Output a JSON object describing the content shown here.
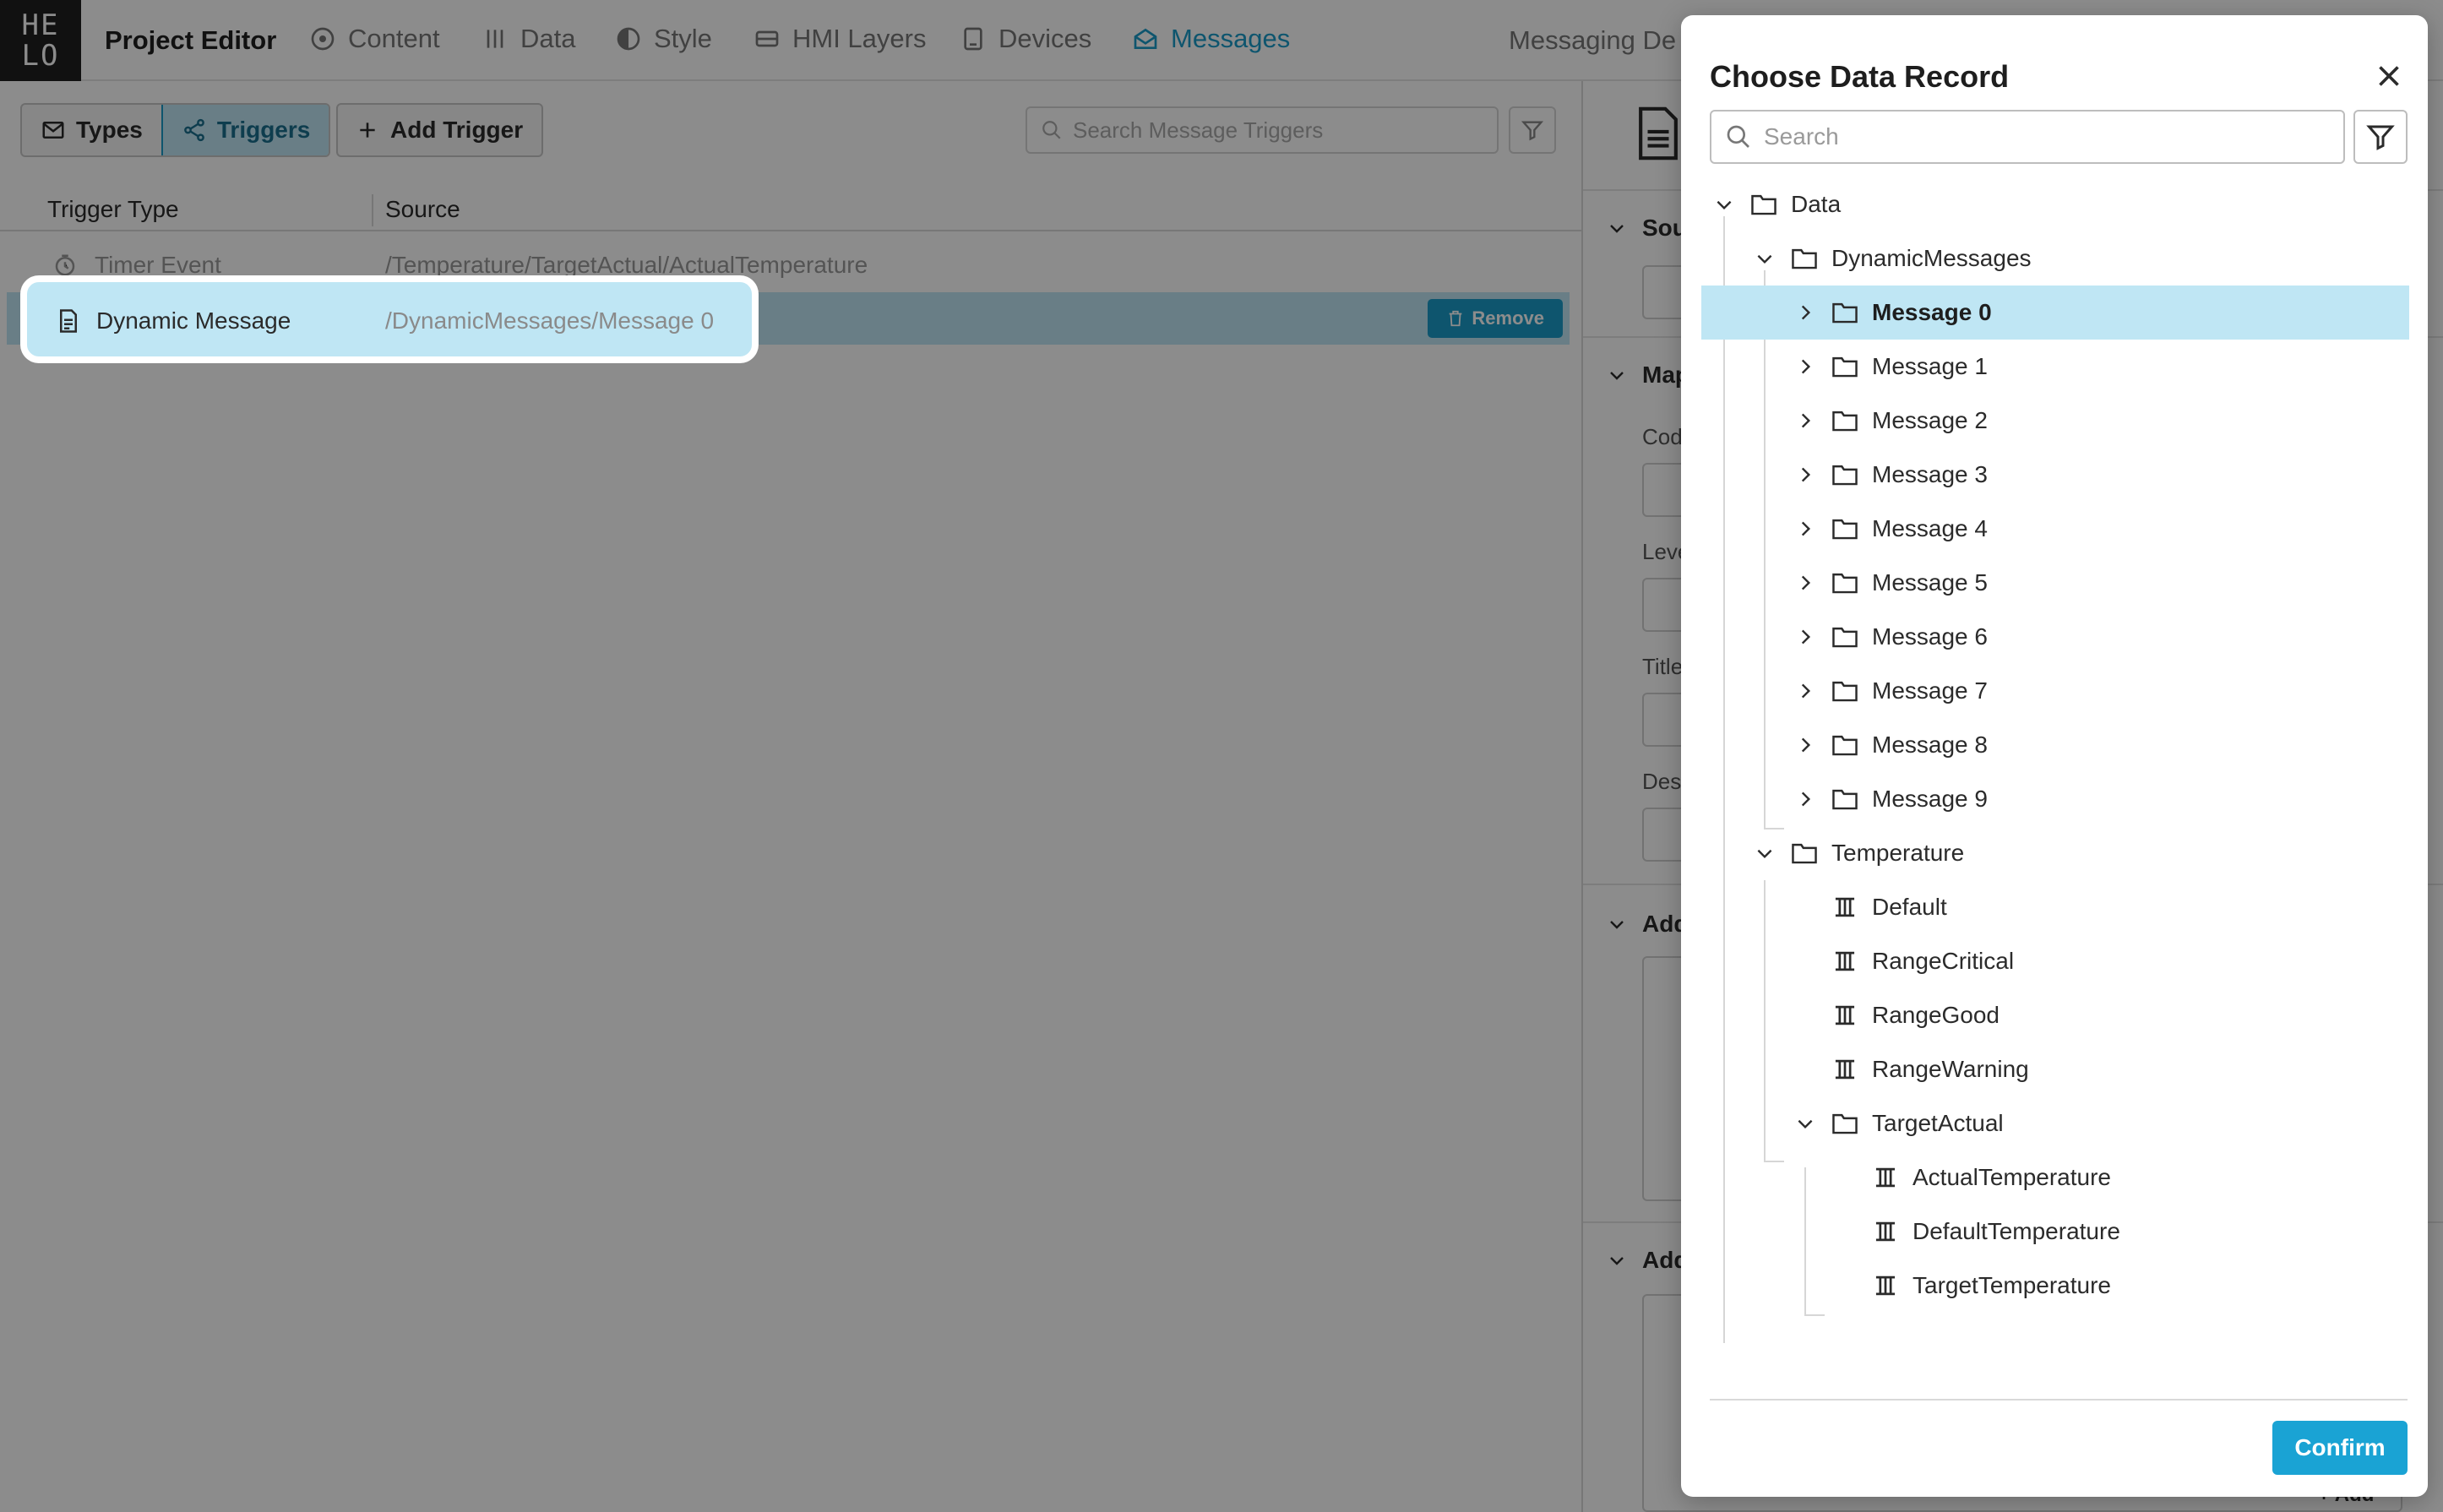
{
  "app": {
    "logo_text": "HE LO",
    "title": "Project Editor"
  },
  "nav": {
    "tabs": [
      {
        "label": "Content",
        "icon": "content-icon"
      },
      {
        "label": "Data",
        "icon": "data-icon"
      },
      {
        "label": "Style",
        "icon": "style-icon"
      },
      {
        "label": "HMI Layers",
        "icon": "layers-icon"
      },
      {
        "label": "Devices",
        "icon": "devices-icon"
      },
      {
        "label": "Messages",
        "icon": "messages-icon",
        "active": true
      }
    ],
    "extra": "Messaging De"
  },
  "toolbar": {
    "types_label": "Types",
    "triggers_label": "Triggers",
    "add_trigger_label": "Add Trigger",
    "search_placeholder": "Search Message Triggers"
  },
  "table": {
    "headers": [
      "Trigger Type",
      "Source"
    ],
    "rows": [
      {
        "type": "Timer Event",
        "source": "/Temperature/TargetActual/ActualTemperature"
      },
      {
        "type": "Dynamic Message",
        "source": "/DynamicMessages/Message 0",
        "selected": true
      }
    ],
    "remove_label": "Remove"
  },
  "side_panel": {
    "sections": [
      "Sou",
      "Map",
      "Add",
      "Add"
    ],
    "labels": [
      "Cod",
      "Leve",
      "Title",
      "Desc"
    ],
    "add_label": "+ Add"
  },
  "modal": {
    "title": "Choose Data Record",
    "search_placeholder": "Search",
    "confirm_label": "Confirm",
    "tree": [
      {
        "label": "Data",
        "depth": 0,
        "kind": "folder",
        "chevron": "down"
      },
      {
        "label": "DynamicMessages",
        "depth": 1,
        "kind": "folder",
        "chevron": "down"
      },
      {
        "label": "Message 0",
        "depth": 2,
        "kind": "folder",
        "chevron": "right",
        "selected": true
      },
      {
        "label": "Message 1",
        "depth": 2,
        "kind": "folder",
        "chevron": "right"
      },
      {
        "label": "Message 2",
        "depth": 2,
        "kind": "folder",
        "chevron": "right"
      },
      {
        "label": "Message 3",
        "depth": 2,
        "kind": "folder",
        "chevron": "right"
      },
      {
        "label": "Message 4",
        "depth": 2,
        "kind": "folder",
        "chevron": "right"
      },
      {
        "label": "Message 5",
        "depth": 2,
        "kind": "folder",
        "chevron": "right"
      },
      {
        "label": "Message 6",
        "depth": 2,
        "kind": "folder",
        "chevron": "right"
      },
      {
        "label": "Message 7",
        "depth": 2,
        "kind": "folder",
        "chevron": "right"
      },
      {
        "label": "Message 8",
        "depth": 2,
        "kind": "folder",
        "chevron": "right"
      },
      {
        "label": "Message 9",
        "depth": 2,
        "kind": "folder",
        "chevron": "right"
      },
      {
        "label": "Temperature",
        "depth": 1,
        "kind": "folder",
        "chevron": "down"
      },
      {
        "label": "Default",
        "depth": 2,
        "kind": "variable",
        "chevron": "none"
      },
      {
        "label": "RangeCritical",
        "depth": 2,
        "kind": "variable",
        "chevron": "none"
      },
      {
        "label": "RangeGood",
        "depth": 2,
        "kind": "variable",
        "chevron": "none"
      },
      {
        "label": "RangeWarning",
        "depth": 2,
        "kind": "variable",
        "chevron": "none"
      },
      {
        "label": "TargetActual",
        "depth": 2,
        "kind": "folder",
        "chevron": "down"
      },
      {
        "label": "ActualTemperature",
        "depth": 3,
        "kind": "variable",
        "chevron": "none"
      },
      {
        "label": "DefaultTemperature",
        "depth": 3,
        "kind": "variable",
        "chevron": "none"
      },
      {
        "label": "TargetTemperature",
        "depth": 3,
        "kind": "variable",
        "chevron": "none"
      }
    ]
  },
  "colors": {
    "accent": "#1a9cc9",
    "selected_bg": "#bfe6f4",
    "confirm": "#1aa3d4"
  }
}
